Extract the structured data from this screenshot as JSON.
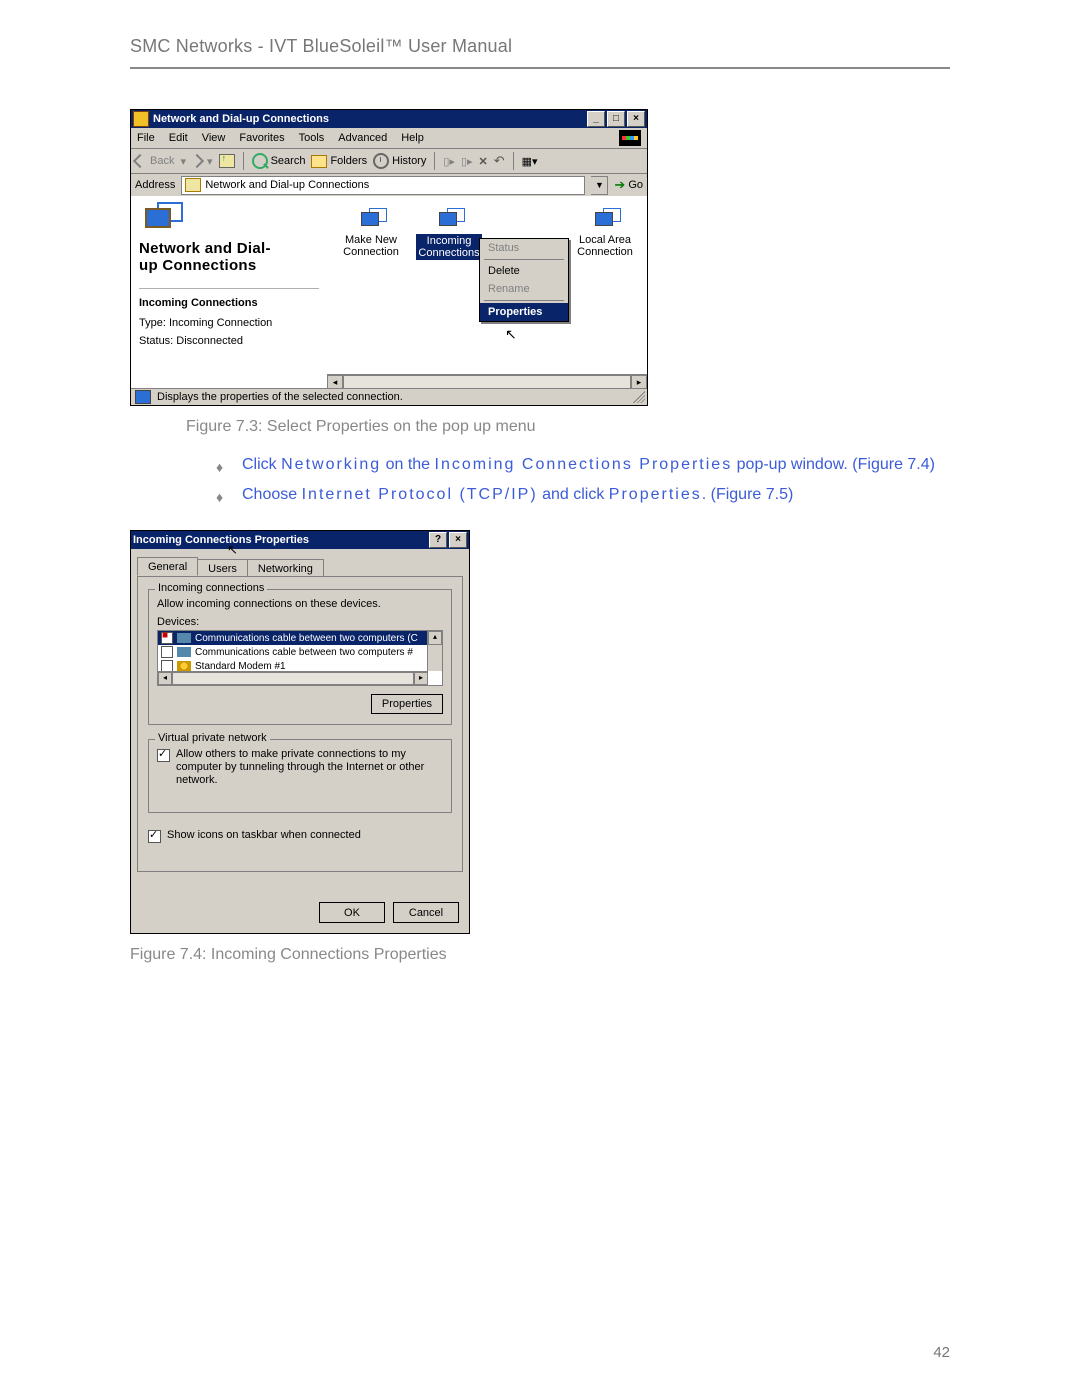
{
  "header": {
    "title": "SMC Networks - IVT BlueSoleil™ User Manual"
  },
  "fig73": {
    "window_title": "Network and Dial-up Connections",
    "menu": {
      "file": "File",
      "edit": "Edit",
      "view": "View",
      "favorites": "Favorites",
      "tools": "Tools",
      "advanced": "Advanced",
      "help": "Help"
    },
    "toolbar": {
      "back": "Back",
      "search": "Search",
      "folders": "Folders",
      "history": "History"
    },
    "addr_label": "Address",
    "addr_value": "Network and Dial-up Connections",
    "go": "Go",
    "leftpane": {
      "title1": "Network and Dial-",
      "title2": "up Connections",
      "subtitle": "Incoming Connections",
      "type": "Type: Incoming Connection",
      "status": "Status: Disconnected"
    },
    "icons": {
      "make_new": {
        "l1": "Make New",
        "l2": "Connection"
      },
      "incoming": {
        "l1": "Incoming",
        "l2": "Connections"
      },
      "lan": {
        "l1": "Local Area",
        "l2": "Connection"
      }
    },
    "ctx": {
      "status": "Status",
      "delete": "Delete",
      "rename": "Rename",
      "properties": "Properties"
    },
    "statusbar": "Displays the properties of the selected connection.",
    "caption": "Figure 7.3: Select Properties on the pop up menu"
  },
  "bullets": {
    "b1": {
      "pre": "Click ",
      "k1": "Networking",
      "mid": " on the ",
      "k2": "Incoming Connections Properties",
      "post": " pop-up window. (Figure 7.4)"
    },
    "b2": {
      "pre": "Choose ",
      "k1": "Internet Protocol (TCP/IP)",
      "mid": " and click ",
      "k2": "Properties",
      "post": ". (Figure 7.5)"
    }
  },
  "fig74": {
    "window_title": "Incoming Connections Properties",
    "tabs": {
      "general": "General",
      "users": "Users",
      "networking": "Networking"
    },
    "group1": {
      "legend": "Incoming connections",
      "instr": "Allow incoming connections on these devices.",
      "devlabel": "Devices:",
      "dev1": "Communications cable between two computers (C",
      "dev2": "Communications cable between two computers #",
      "dev3": "Standard Modem #1",
      "props": "Properties"
    },
    "group2": {
      "legend": "Virtual private network",
      "vpn": "Allow others to make private connections to my computer by tunneling through the Internet or other network."
    },
    "showicons": "Show icons on taskbar when connected",
    "ok": "OK",
    "cancel": "Cancel",
    "caption": "Figure 7.4: Incoming Connections Properties"
  },
  "pagenum": "42"
}
